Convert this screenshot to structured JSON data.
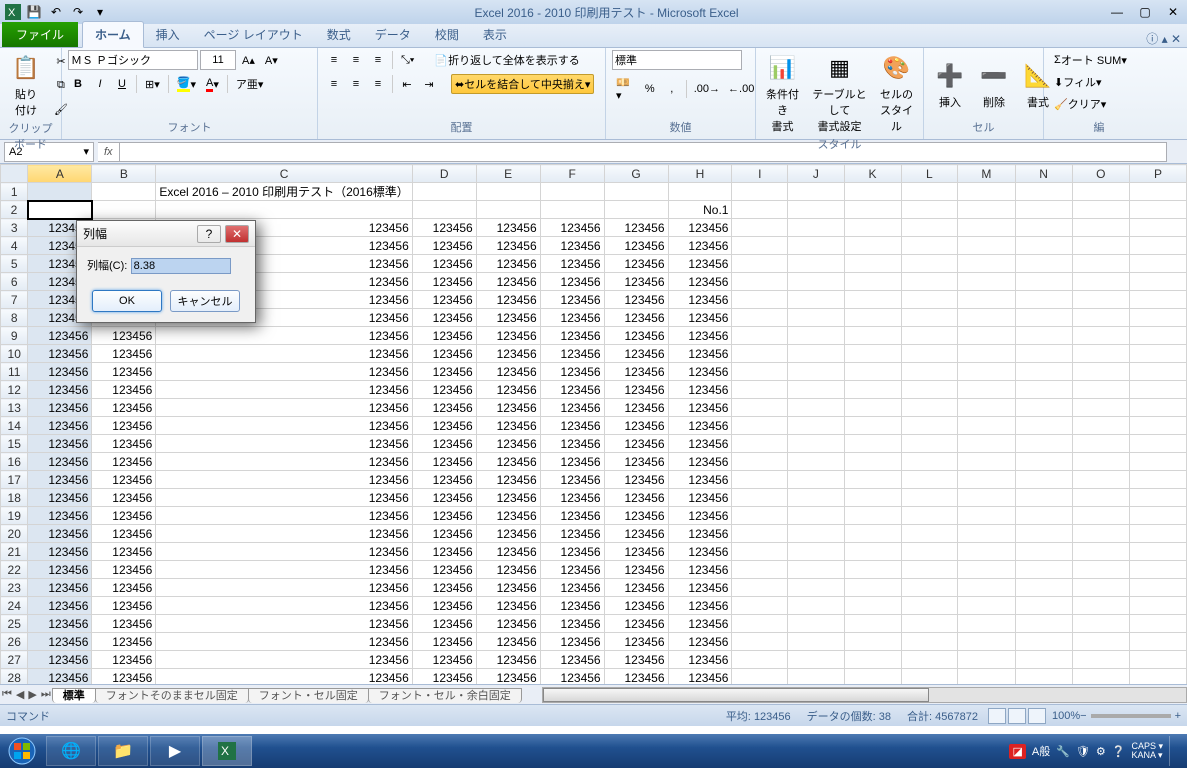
{
  "title": "Excel 2016 - 2010 印刷用テスト - Microsoft Excel",
  "tabs": {
    "file": "ファイル",
    "home": "ホーム",
    "insert": "挿入",
    "pageLayout": "ページ レイアウト",
    "formulas": "数式",
    "data": "データ",
    "review": "校閲",
    "view": "表示"
  },
  "ribbon": {
    "clipboard": {
      "title": "クリップボード",
      "paste": "貼り付け"
    },
    "font": {
      "title": "フォント",
      "name": "ＭＳ Ｐゴシック",
      "size": "11",
      "bold": "B",
      "italic": "I",
      "underline": "U"
    },
    "alignment": {
      "title": "配置",
      "wrap": "折り返して全体を表示する",
      "merge": "セルを結合して中央揃え"
    },
    "number": {
      "title": "数値",
      "format": "標準"
    },
    "styles": {
      "title": "スタイル",
      "cond": "条件付き\n書式",
      "table": "テーブルとして\n書式設定",
      "cell": "セルの\nスタイル"
    },
    "cells": {
      "title": "セル",
      "insert": "挿入",
      "delete": "削除",
      "format": "書式"
    },
    "editing": {
      "title": "編",
      "autosum": "オート SUM",
      "fill": "フィル",
      "clear": "クリア"
    }
  },
  "namebox": "A2",
  "sheet": {
    "columns": [
      "A",
      "B",
      "C",
      "D",
      "E",
      "F",
      "G",
      "H",
      "I",
      "J",
      "K",
      "L",
      "M",
      "N",
      "O",
      "P"
    ],
    "num_rows": 28,
    "row1": {
      "col_c_span": "Excel 2016 – 2010 印刷用テスト（2016標準）"
    },
    "row2": {
      "col_h": "No.1"
    },
    "data_value": "123456",
    "data_start_row": 3,
    "data_end_row": 28,
    "data_cols": [
      "A",
      "B",
      "C",
      "D",
      "E",
      "F",
      "G",
      "H"
    ],
    "selected_col": "A",
    "active_cell": "A2"
  },
  "chart_data": {
    "type": "table",
    "columns": [
      "A",
      "B",
      "C",
      "D",
      "E",
      "F",
      "G",
      "H"
    ],
    "row_range": [
      3,
      28
    ],
    "cell_value": 123456,
    "header_row1_C": "Excel 2016 – 2010 印刷用テスト（2016標準）",
    "header_row2_H": "No.1"
  },
  "sheettabs": [
    "標準",
    "フォントそのままセル固定",
    "フォント・セル固定",
    "フォント・セル・余白固定"
  ],
  "status": {
    "mode": "コマンド",
    "avg_label": "平均:",
    "avg": "123456",
    "count_label": "データの個数:",
    "count": "38",
    "sum_label": "合計:",
    "sum": "4567872",
    "zoom": "100%"
  },
  "dialog": {
    "title": "列幅",
    "label": "列幅(C):",
    "value": "8.38",
    "ok": "OK",
    "cancel": "キャンセル"
  },
  "ime": {
    "mode": "A般",
    "caps": "CAPS",
    "kana": "KANA"
  }
}
